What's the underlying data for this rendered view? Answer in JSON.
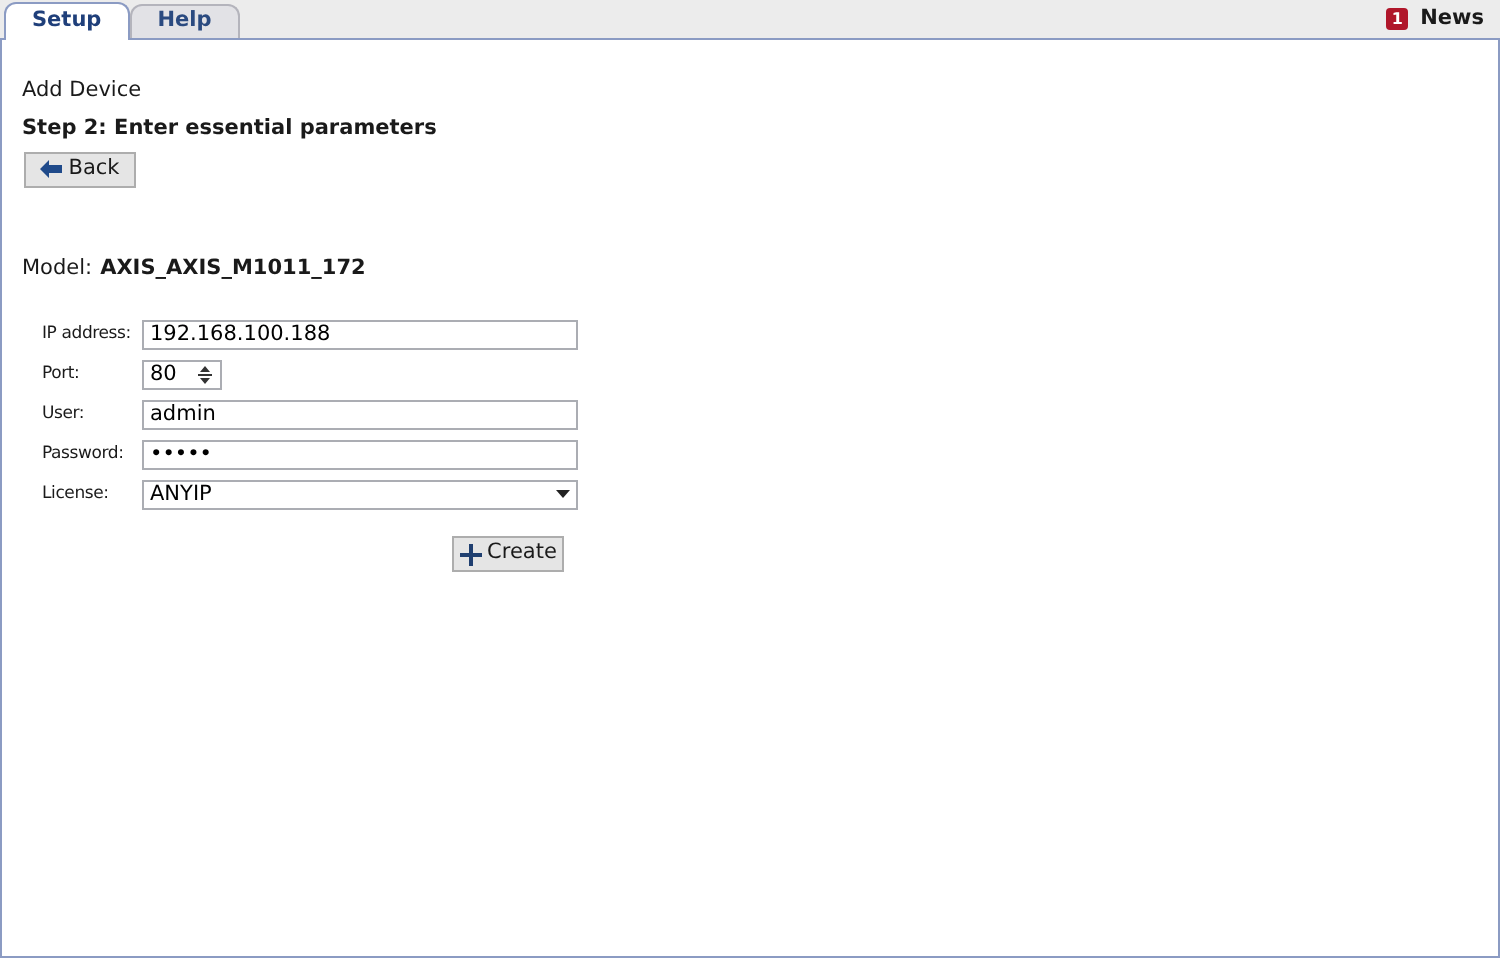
{
  "tabs": [
    {
      "label": "Setup",
      "selected": true
    },
    {
      "label": "Help",
      "selected": false
    }
  ],
  "news": {
    "badge": "1",
    "label": "News"
  },
  "heading": "Add Device",
  "step": "Step 2: Enter essential parameters",
  "back_button": "Back",
  "model": {
    "label": "Model:",
    "value": "AXIS_AXIS_M1011_172"
  },
  "fields": [
    {
      "kind": "text",
      "label": "IP address:",
      "value": "192.168.100.188"
    },
    {
      "kind": "spinner",
      "label": "Port:",
      "value": "80"
    },
    {
      "kind": "text",
      "label": "User:",
      "value": "admin"
    },
    {
      "kind": "text",
      "label": "Password:",
      "value": "•••••"
    },
    {
      "kind": "dropdown",
      "label": "License:",
      "value": "ANYIP"
    }
  ],
  "create_button": "Create"
}
